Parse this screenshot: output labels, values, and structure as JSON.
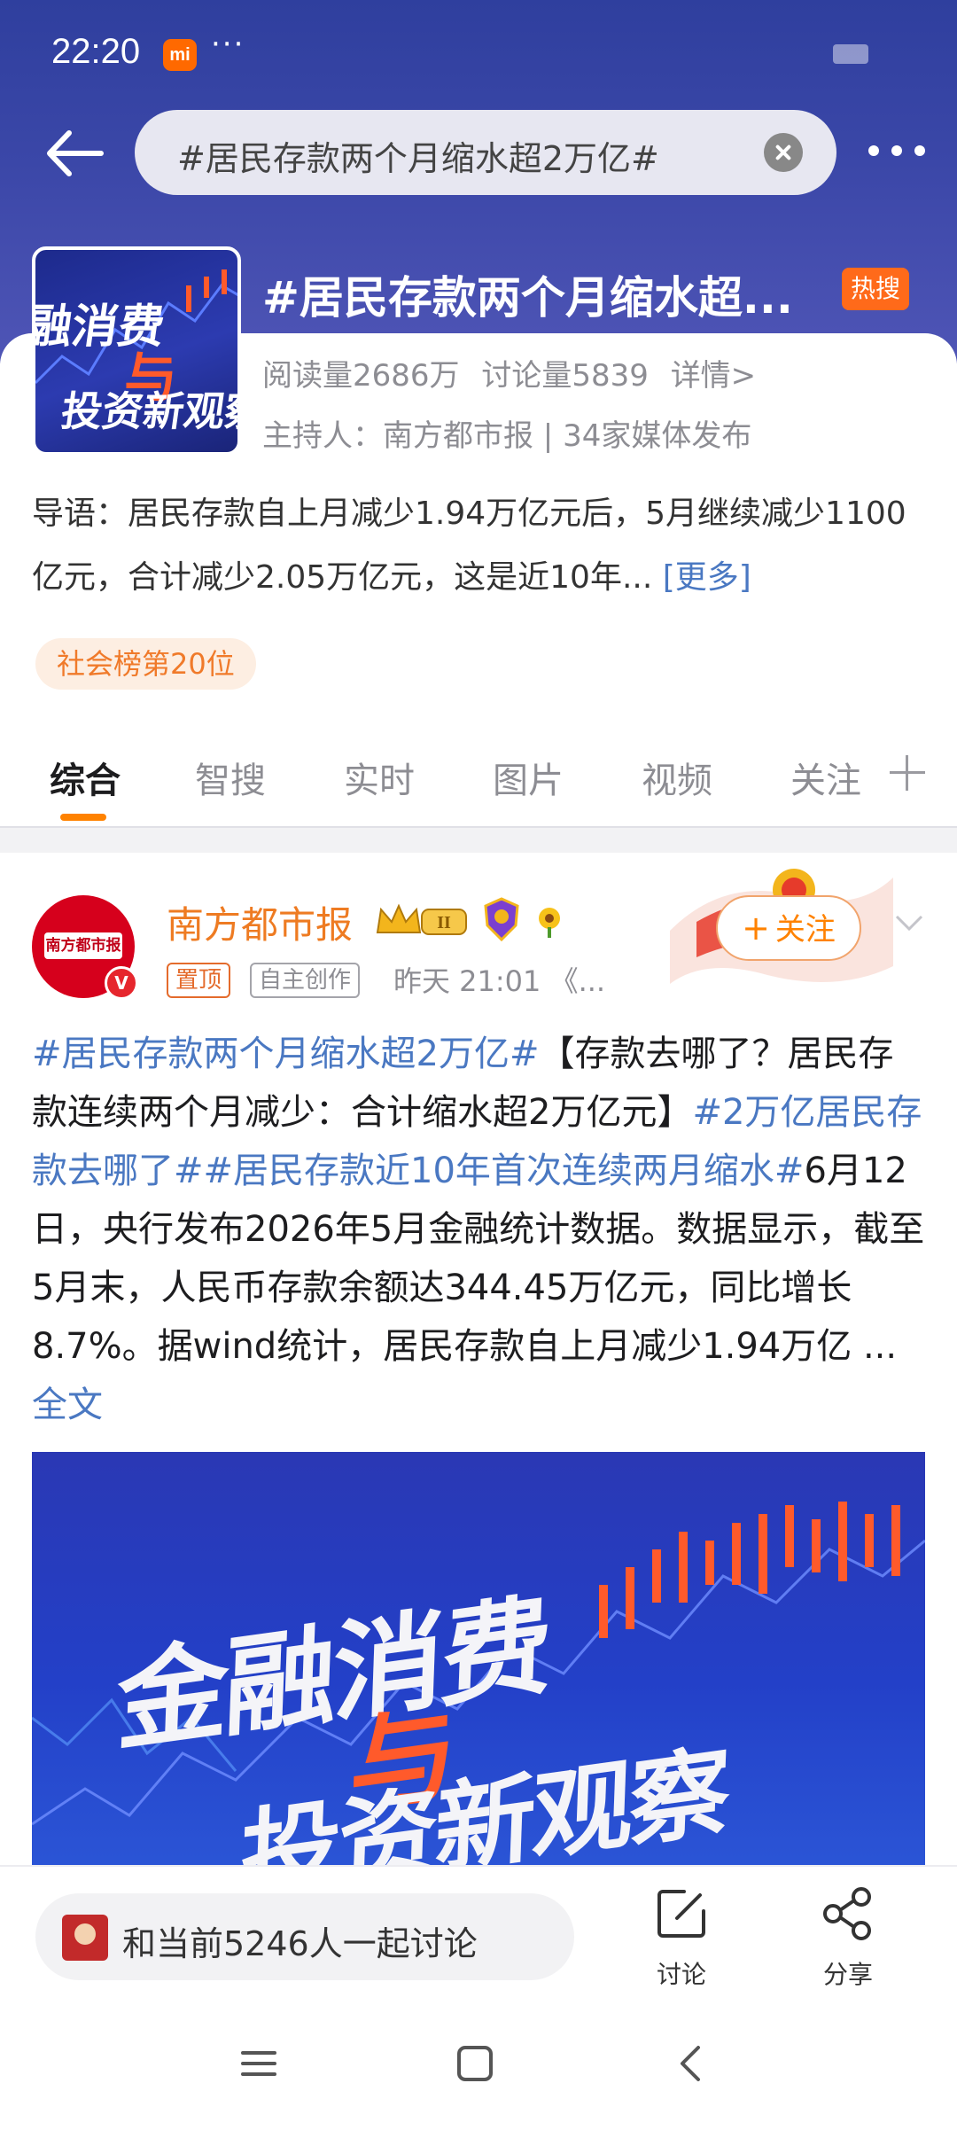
{
  "status_bar": {
    "time": "22:20",
    "app_badge": "mi",
    "overflow": "···"
  },
  "header": {
    "search_query": "#居民存款两个月缩水超2万亿#",
    "icons": {
      "back": "back-arrow-icon",
      "clear": "clear-icon",
      "menu": "more-icon"
    }
  },
  "topic": {
    "title": "#居民存款两个月缩水超...",
    "hot_badge": "热搜",
    "thumb_line1": "融消费",
    "thumb_mark": "与",
    "thumb_line2": "投资新观察",
    "stats": {
      "reads": "阅读量2686万",
      "discussions": "讨论量5839",
      "details": "详情>"
    },
    "host": "主持人：南方都市报 | 34家媒体发布",
    "intro": "导语：居民存款自上月减少1.94万亿元后，5月继续减少1100亿元，合计减少2.05万亿元，这是近10年...",
    "intro_more": "[更多]",
    "rank_badge": "社会榜第20位"
  },
  "tabs": [
    "综合",
    "智搜",
    "实时",
    "图片",
    "视频",
    "关注"
  ],
  "active_tab": "综合",
  "post": {
    "avatar_text": "南方都市报",
    "verified_mark": "V",
    "author": "南方都市报",
    "crown_level": "II",
    "follow_label": "关注",
    "follow_plus": "+",
    "tag_pinned": "置顶",
    "tag_original": "自主创作",
    "time": "昨天 21:01  《...",
    "body": {
      "topic1": "#居民存款两个月缩水超2万亿#",
      "text1": "【存款去哪了？居民存款连续两个月减少：合计缩水超2万亿元】",
      "topic2": "#2万亿居民存款去哪了#",
      "topic3": "#居民存款近10年首次连续两月缩水#",
      "text2": "6月12日，央行发布2026年5月金融统计数据。数据显示，截至5月末，人民币存款余额达344.45万亿元，同比增长8.7%。据wind统计，居民存款自上月减少1.94万亿 ...",
      "full_text": "全文"
    },
    "image_line1": "金融消费",
    "image_mark": "与",
    "image_line2": "投资新观察"
  },
  "bottom_bar": {
    "discuss_prompt": "和当前5246人一起讨论",
    "discuss_label": "讨论",
    "share_label": "分享"
  },
  "colors": {
    "header": "#3b47a8",
    "accent_orange": "#ff8200",
    "link_blue": "#4a78c2",
    "hot_badge": "#ff6a1a"
  }
}
